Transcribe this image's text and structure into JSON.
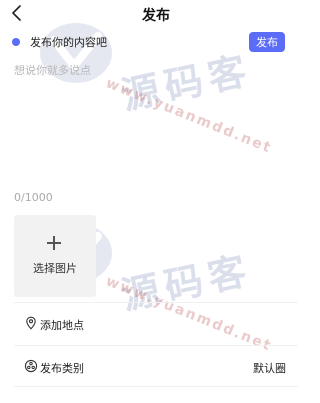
{
  "nav": {
    "title": "发布",
    "back_icon": "chevron-left-icon"
  },
  "compose": {
    "heading": "发布你的内容吧",
    "publish_label": "发布",
    "accent_color": "#5b6cf6",
    "placeholder": "想说你就多说点",
    "value": "",
    "char_count": "0/1000"
  },
  "image_picker": {
    "label": "选择图片",
    "icon": "plus-icon"
  },
  "rows": {
    "location": {
      "label": "添加地点",
      "icon": "location-pin-icon"
    },
    "category": {
      "label": "发布类别",
      "value": "默认圈",
      "icon": "category-icon"
    }
  },
  "watermark": {
    "logo_text": "源码客",
    "url": "www.yuanmdd.net"
  }
}
